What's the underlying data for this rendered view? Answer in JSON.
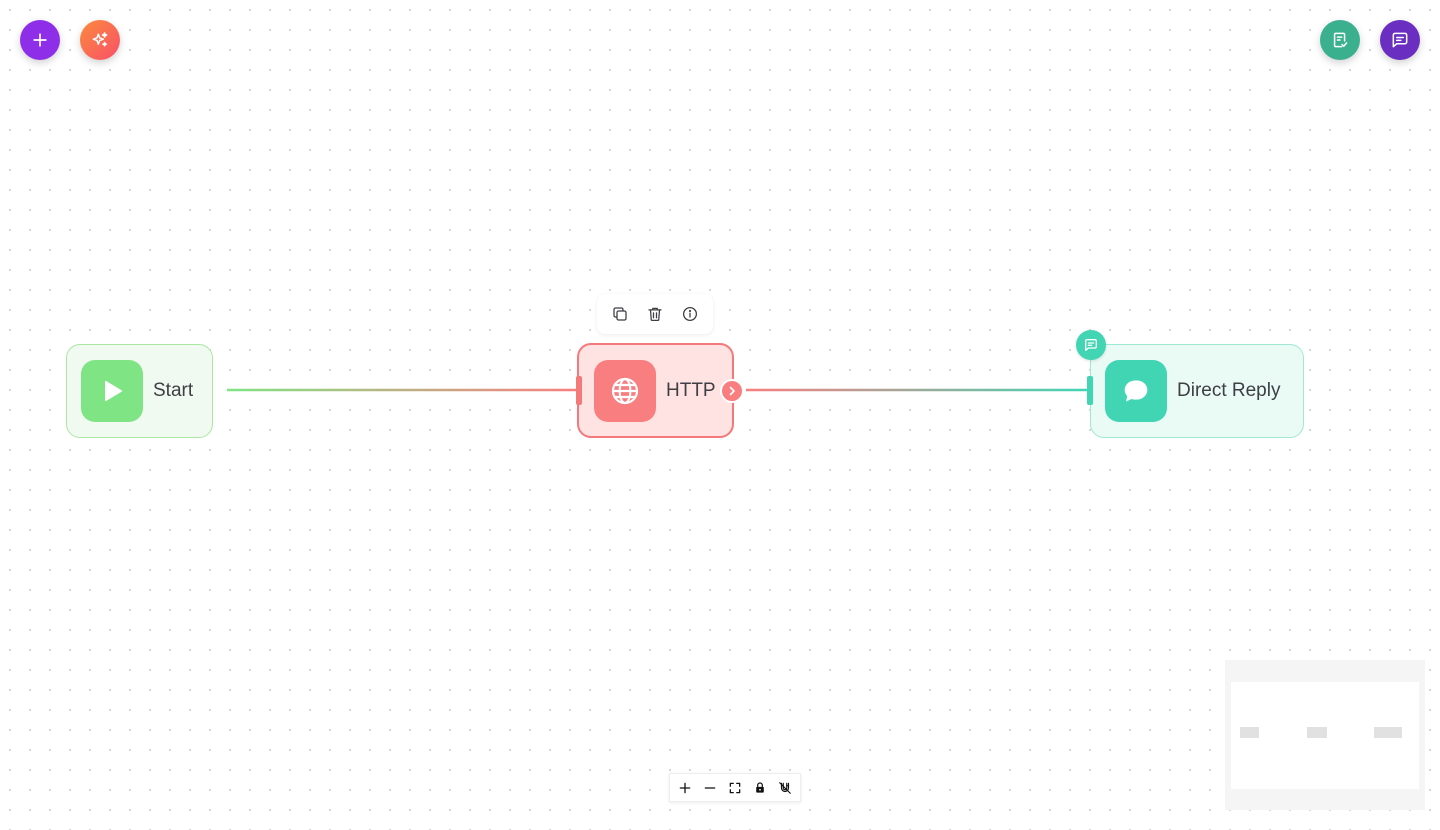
{
  "canvas": {
    "background": "#ffffff",
    "dot_color": "#cfd3d8"
  },
  "top_left": {
    "add_button": {
      "icon": "plus-icon",
      "color": "#8f2ee8"
    },
    "generate_button": {
      "icon": "sparkles-icon",
      "color": "#fb6a4a"
    }
  },
  "top_right": {
    "validate_button": {
      "icon": "clipboard-check-icon",
      "color": "#3bb08f"
    },
    "chat_button": {
      "icon": "message-square-icon",
      "color": "#6a2fc0"
    }
  },
  "nodes": {
    "start": {
      "label": "Start",
      "icon": "play-icon",
      "color": "#7fe483"
    },
    "http": {
      "label": "HTTP",
      "icon": "globe-icon",
      "color": "#f97e80",
      "selected": true
    },
    "reply": {
      "label": "Direct Reply",
      "icon": "chat-bubble-icon",
      "color": "#41d5b3"
    }
  },
  "node_toolbar": {
    "items": [
      "copy-icon",
      "trash-icon",
      "info-icon"
    ]
  },
  "edges": [
    {
      "from": "Start",
      "to": "HTTP"
    },
    {
      "from": "HTTP",
      "to": "Direct Reply"
    }
  ],
  "controls": {
    "items": [
      "zoom-in-icon",
      "zoom-out-icon",
      "fit-view-icon",
      "lock-icon",
      "magnet-off-icon"
    ]
  }
}
